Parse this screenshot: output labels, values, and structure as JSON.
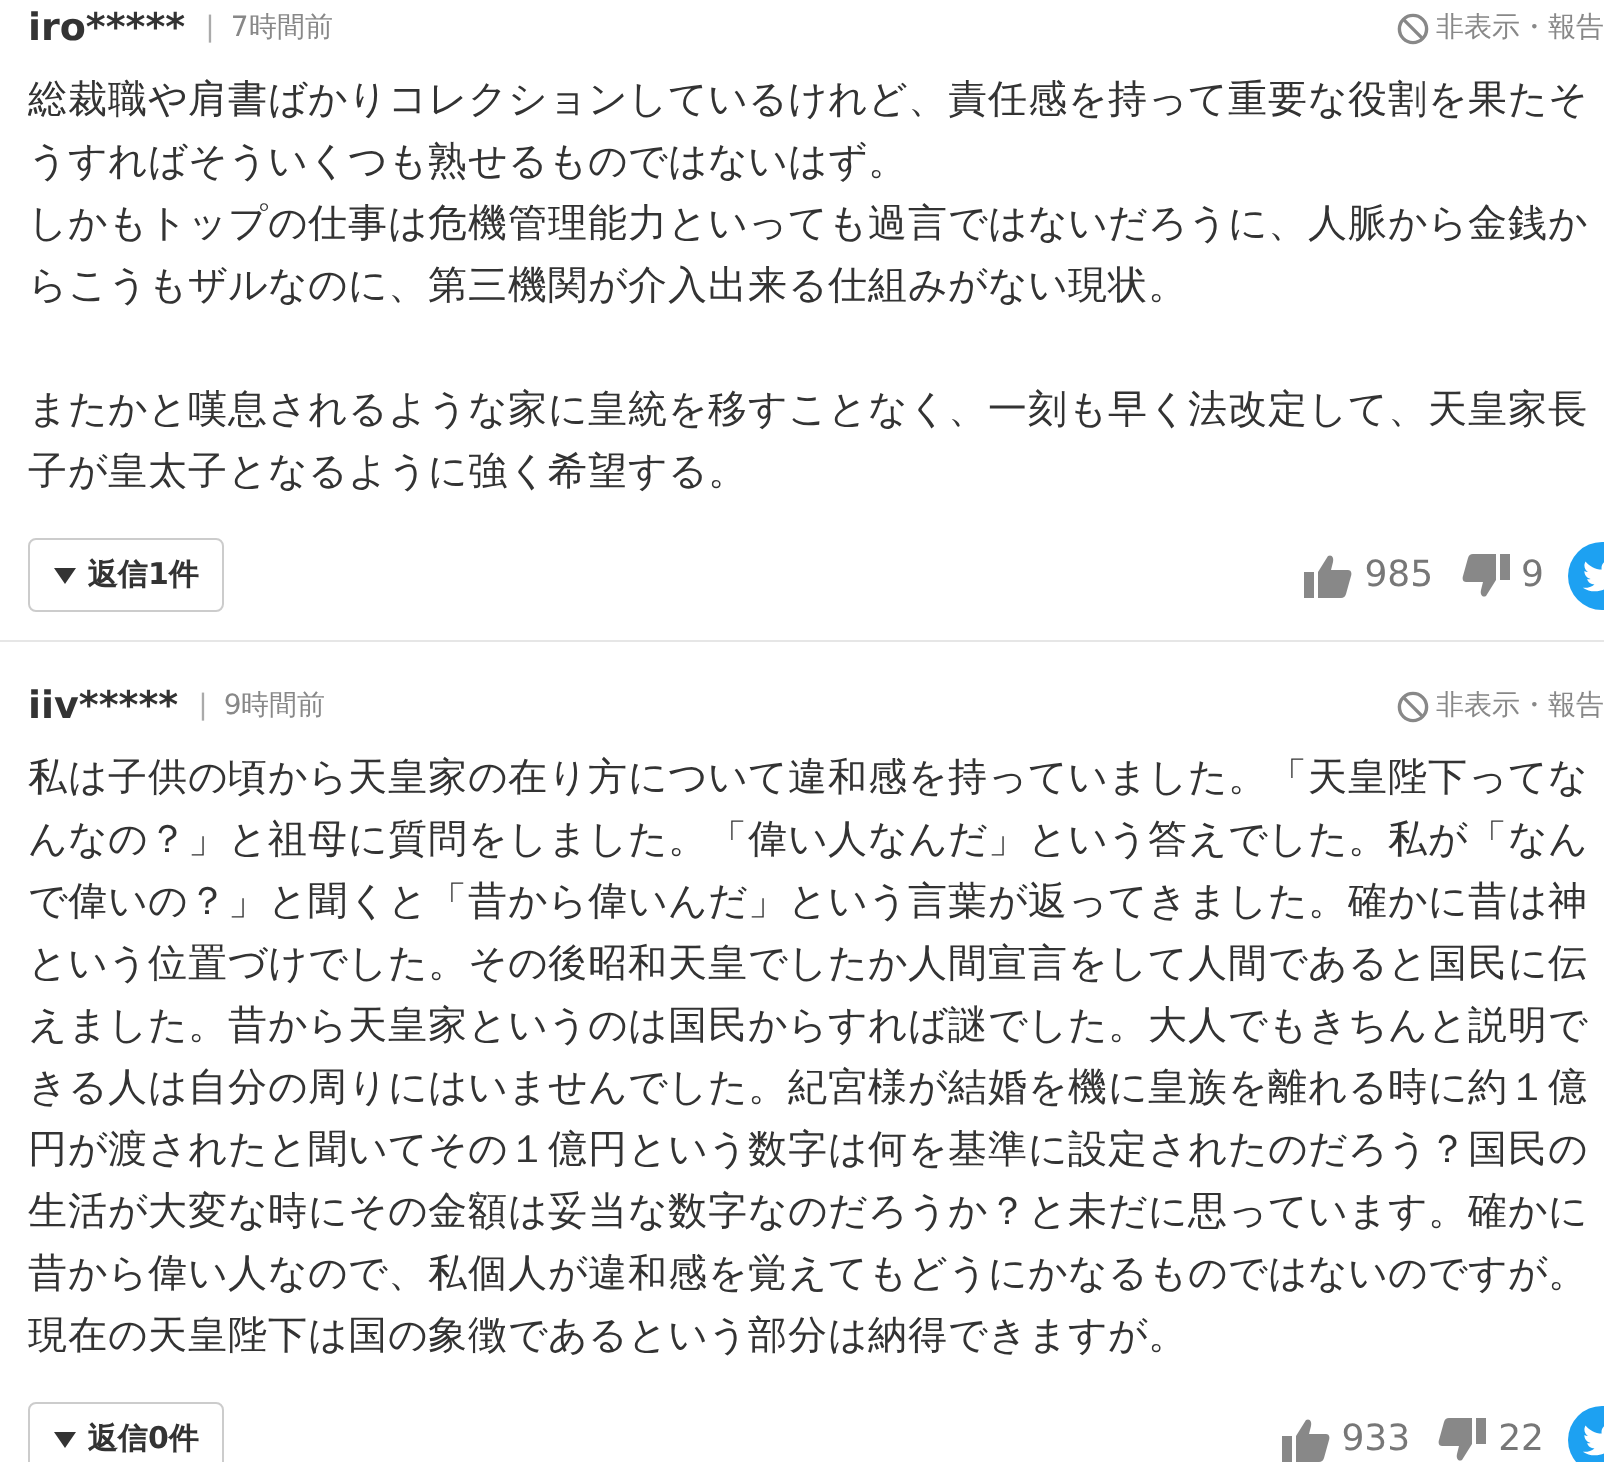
{
  "comments": [
    {
      "user": "iro*****",
      "separator": "|",
      "time": "7時間前",
      "action": "非表示・報告",
      "body": [
        [
          "総裁職や肩書ばかりコレクションしているけれど、責任感を持って重要な役割を果たそうすればそういくつも熟せるものではないはず。",
          "しかもトップの仕事は危機管理能力といっても過言ではないだろうに、人脈から金銭からこうもザルなのに、第三機関が介入出来る仕組みがない現状。"
        ],
        [
          "またかと嘆息されるような家に皇統を移すことなく、一刻も早く法改定して、天皇家長子が皇太子となるように強く希望する。"
        ]
      ],
      "reply": "返信1件",
      "likes": "985",
      "dislikes": "9"
    },
    {
      "user": "iiv*****",
      "separator": "|",
      "time": "9時間前",
      "action": "非表示・報告",
      "body": [
        [
          "私は子供の頃から天皇家の在り方について違和感を持っていました。「天皇陛下ってなんなの？」と祖母に質問をしました。「偉い人なんだ」という答えでした。私が「なんで偉いの？」と聞くと「昔から偉いんだ」という言葉が返ってきました。確かに昔は神という位置づけでした。その後昭和天皇でしたか人間宣言をして人間であると国民に伝えました。昔から天皇家というのは国民からすれば謎でした。大人でもきちんと説明できる人は自分の周りにはいませんでした。紀宮様が結婚を機に皇族を離れる時に約１億円が渡されたと聞いてその１億円という数字は何を基準に設定されたのだろう？国民の生活が大変な時にその金額は妥当な数字なのだろうか？と未だに思っています。確かに昔から偉い人なので、私個人が違和感を覚えてもどうにかなるものではないのですが。現在の天皇陛下は国の象徴であるという部分は納得できますが。"
        ]
      ],
      "reply": "返信0件",
      "likes": "933",
      "dislikes": "22"
    }
  ]
}
